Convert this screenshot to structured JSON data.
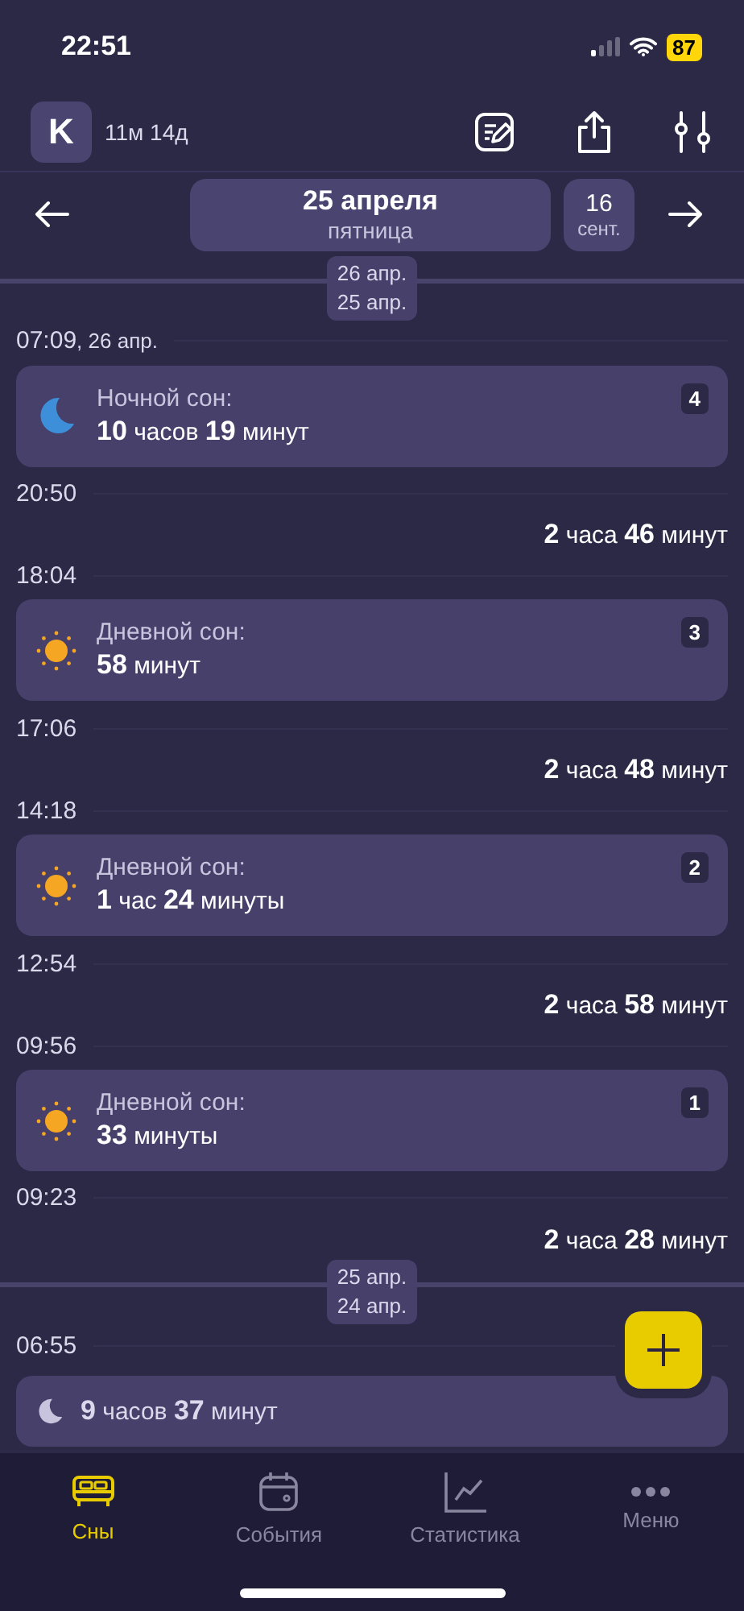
{
  "status_bar": {
    "time": "22:51",
    "battery": "87"
  },
  "header": {
    "avatar": "K",
    "age": "11м 14д"
  },
  "date_nav": {
    "date": "25 апреля",
    "weekday": "пятница",
    "other_day": "16",
    "other_month": "сент."
  },
  "timeline": [
    {
      "kind": "divider",
      "upper": "26 апр.",
      "lower": "25 апр."
    },
    {
      "kind": "time",
      "time": "07:09",
      "suffix": ", 26 апр."
    },
    {
      "kind": "night",
      "label": "Ночной сон:",
      "duration": "**10** часов **19** минут",
      "count": "4"
    },
    {
      "kind": "time",
      "time": "20:50"
    },
    {
      "kind": "gap",
      "duration": "**2** часа **46** минут"
    },
    {
      "kind": "time",
      "time": "18:04"
    },
    {
      "kind": "day",
      "label": "Дневной сон:",
      "duration": "**58** минут",
      "count": "3"
    },
    {
      "kind": "time",
      "time": "17:06"
    },
    {
      "kind": "gap",
      "duration": "**2** часа **48** минут"
    },
    {
      "kind": "time",
      "time": "14:18"
    },
    {
      "kind": "day",
      "label": "Дневной сон:",
      "duration": "**1** час **24** минуты",
      "count": "2"
    },
    {
      "kind": "time",
      "time": "12:54"
    },
    {
      "kind": "gap",
      "duration": "**2** часа **58** минут"
    },
    {
      "kind": "time",
      "time": "09:56"
    },
    {
      "kind": "day",
      "label": "Дневной сон:",
      "duration": "**33** минуты",
      "count": "1"
    },
    {
      "kind": "time",
      "time": "09:23"
    },
    {
      "kind": "gap",
      "duration": "**2** часа **28** минут"
    },
    {
      "kind": "divider",
      "upper": "25 апр.",
      "lower": "24 апр."
    },
    {
      "kind": "time",
      "time": "06:55"
    },
    {
      "kind": "compact_night",
      "duration": "**9** часов **37** минут"
    }
  ],
  "tabs": [
    {
      "label": "Сны",
      "selected": true
    },
    {
      "label": "События",
      "selected": false
    },
    {
      "label": "Статистика",
      "selected": false
    },
    {
      "label": "Меню",
      "selected": false
    }
  ]
}
